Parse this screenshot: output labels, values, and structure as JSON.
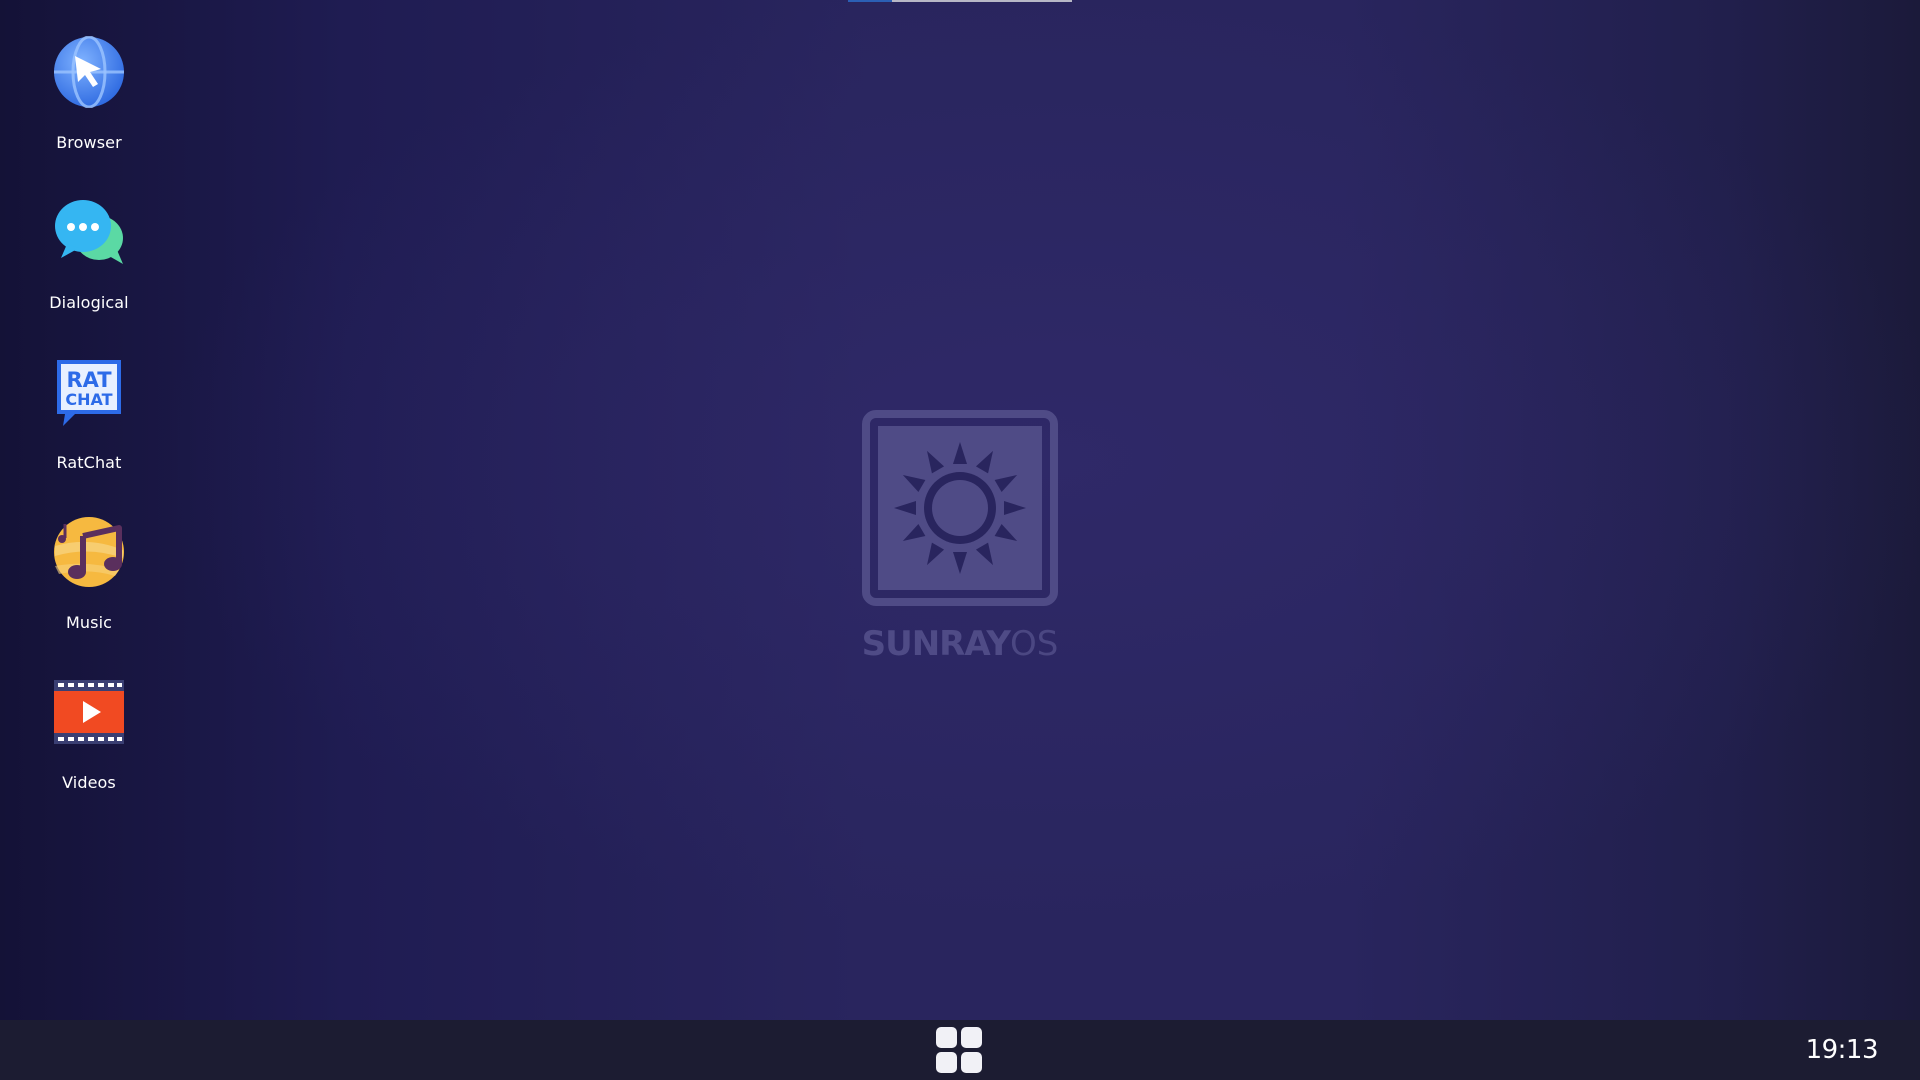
{
  "desktop": {
    "icons": [
      {
        "label": "Browser",
        "icon": "browser-icon"
      },
      {
        "label": "Dialogical",
        "icon": "chat-bubbles-icon"
      },
      {
        "label": "RatChat",
        "icon": "ratchat-icon",
        "icon_text_line1": "RAT",
        "icon_text_line2": "CHAT"
      },
      {
        "label": "Music",
        "icon": "music-note-icon"
      },
      {
        "label": "Videos",
        "icon": "video-play-icon"
      }
    ],
    "wallpaper_logo": {
      "icon": "sun-logo-icon",
      "name_bold": "SUNRAY",
      "name_light": "OS"
    }
  },
  "taskbar": {
    "start_icon": "app-grid-icon",
    "clock": "19:13"
  },
  "colors": {
    "desktop_background": "#29255e",
    "taskbar_background": "#1c1c32",
    "logo_color": "#4f4b86"
  }
}
